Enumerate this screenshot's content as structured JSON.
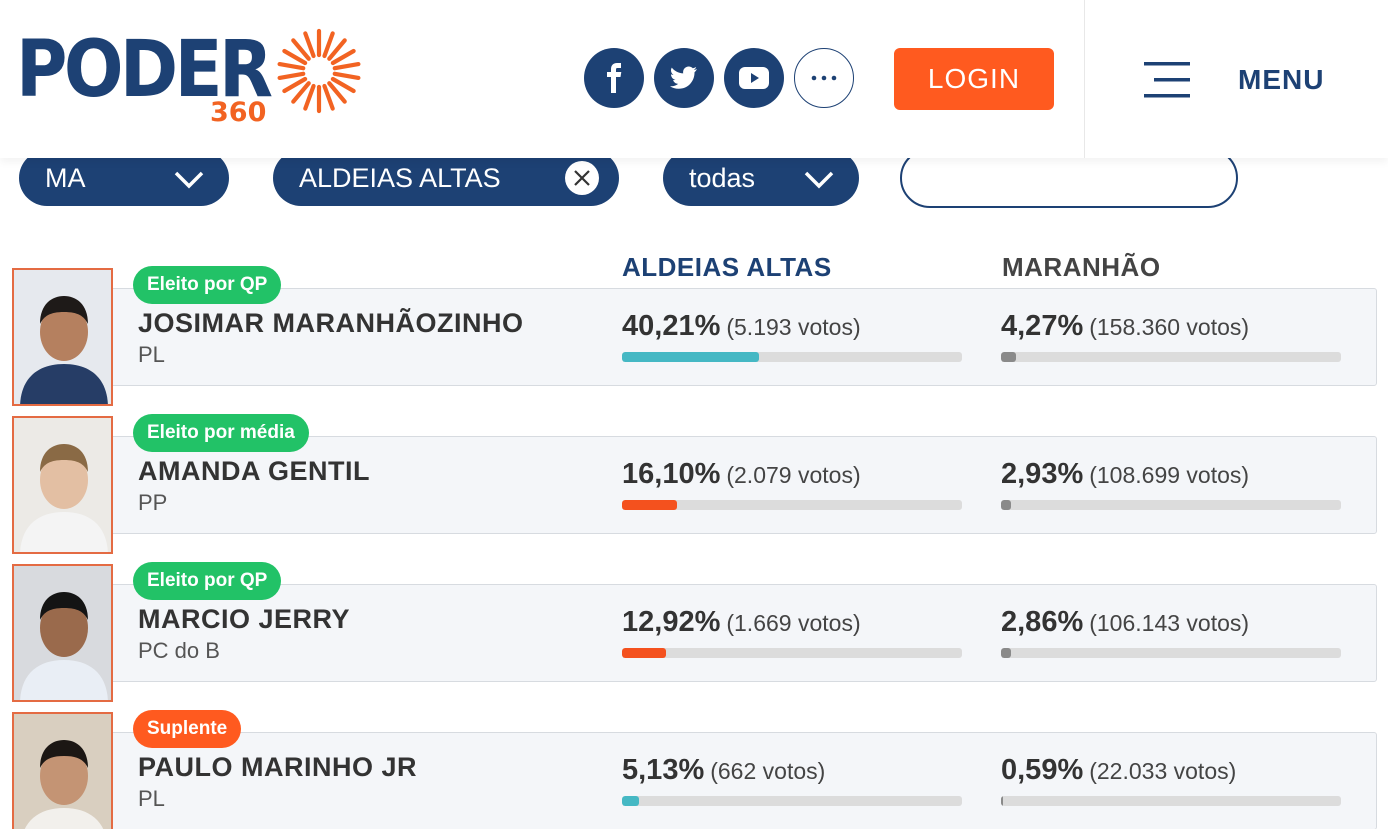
{
  "header": {
    "logo_text": "PODER",
    "logo_sub": "360",
    "login_label": "LOGIN",
    "menu_label": "MENU",
    "social": [
      "facebook-icon",
      "twitter-icon",
      "youtube-icon",
      "more-icon"
    ]
  },
  "filters": {
    "state": "MA",
    "city": "ALDEIAS ALTAS",
    "scope": "todas",
    "search_value": ""
  },
  "columns": {
    "local": "ALDEIAS ALTAS",
    "state": "MARANHÃO"
  },
  "colors": {
    "brand_blue": "#1d4174",
    "brand_orange": "#ff5a1f",
    "green_badge": "#22c267",
    "teal_bar": "#45b8c4",
    "orange_bar": "#f4511e",
    "gray_bar": "#8a8a8a"
  },
  "candidates": [
    {
      "badge": "Eleito por QP",
      "badge_color": "green",
      "name": "JOSIMAR MARANHÃOZINHO",
      "party": "PL",
      "local_pct": "40,21%",
      "local_votes": "(5.193 votos)",
      "local_fraction": 0.4021,
      "local_bar_color": "#45b8c4",
      "state_pct": "4,27%",
      "state_votes": "(158.360 votos)",
      "state_fraction": 0.0427
    },
    {
      "badge": "Eleito por média",
      "badge_color": "green",
      "name": "AMANDA GENTIL",
      "party": "PP",
      "local_pct": "16,10%",
      "local_votes": "(2.079 votos)",
      "local_fraction": 0.161,
      "local_bar_color": "#f4511e",
      "state_pct": "2,93%",
      "state_votes": "(108.699 votos)",
      "state_fraction": 0.0293
    },
    {
      "badge": "Eleito por QP",
      "badge_color": "green",
      "name": "MARCIO JERRY",
      "party": "PC do B",
      "local_pct": "12,92%",
      "local_votes": "(1.669 votos)",
      "local_fraction": 0.1292,
      "local_bar_color": "#f4511e",
      "state_pct": "2,86%",
      "state_votes": "(106.143 votos)",
      "state_fraction": 0.0286
    },
    {
      "badge": "Suplente",
      "badge_color": "orange",
      "name": "PAULO MARINHO JR",
      "party": "PL",
      "local_pct": "5,13%",
      "local_votes": "(662 votos)",
      "local_fraction": 0.0513,
      "local_bar_color": "#45b8c4",
      "state_pct": "0,59%",
      "state_votes": "(22.033 votos)",
      "state_fraction": 0.0059
    }
  ]
}
